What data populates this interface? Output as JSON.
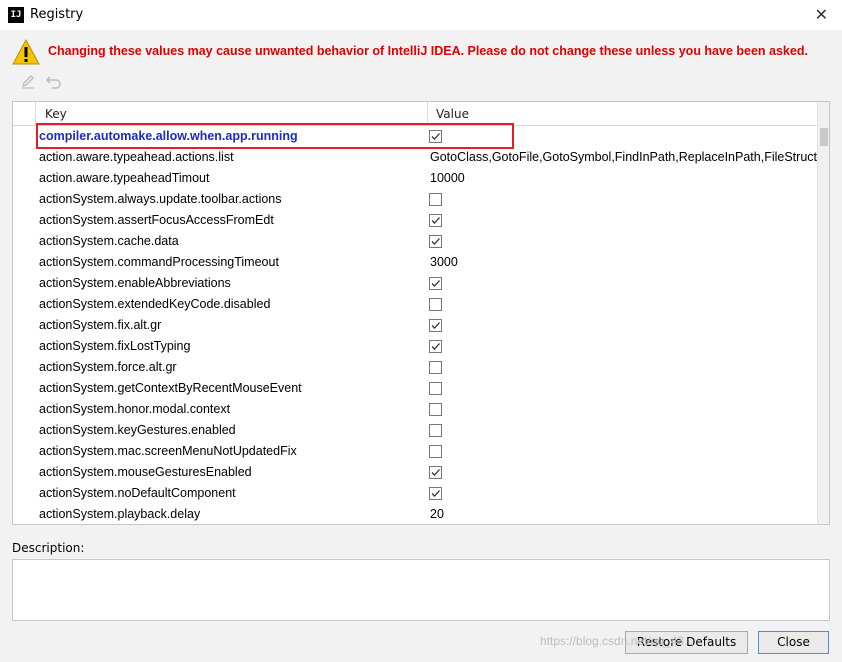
{
  "window": {
    "app_icon_text": "IJ",
    "title": "Registry"
  },
  "warning": {
    "text": "Changing these values may cause unwanted behavior of IntelliJ IDEA. Please do not change these unless you have been asked."
  },
  "table": {
    "columns": {
      "key": "Key",
      "value": "Value"
    },
    "rows": [
      {
        "key": "compiler.automake.allow.when.app.running",
        "type": "checkbox",
        "checked": true,
        "selected": true
      },
      {
        "key": "action.aware.typeahead.actions.list",
        "type": "text",
        "value": "GotoClass,GotoFile,GotoSymbol,FindInPath,ReplaceInPath,FileStruct"
      },
      {
        "key": "action.aware.typeaheadTimout",
        "type": "text",
        "value": "10000"
      },
      {
        "key": "actionSystem.always.update.toolbar.actions",
        "type": "checkbox",
        "checked": false
      },
      {
        "key": "actionSystem.assertFocusAccessFromEdt",
        "type": "checkbox",
        "checked": true
      },
      {
        "key": "actionSystem.cache.data",
        "type": "checkbox",
        "checked": true
      },
      {
        "key": "actionSystem.commandProcessingTimeout",
        "type": "text",
        "value": "3000"
      },
      {
        "key": "actionSystem.enableAbbreviations",
        "type": "checkbox",
        "checked": true
      },
      {
        "key": "actionSystem.extendedKeyCode.disabled",
        "type": "checkbox",
        "checked": false
      },
      {
        "key": "actionSystem.fix.alt.gr",
        "type": "checkbox",
        "checked": true
      },
      {
        "key": "actionSystem.fixLostTyping",
        "type": "checkbox",
        "checked": true
      },
      {
        "key": "actionSystem.force.alt.gr",
        "type": "checkbox",
        "checked": false
      },
      {
        "key": "actionSystem.getContextByRecentMouseEvent",
        "type": "checkbox",
        "checked": false
      },
      {
        "key": "actionSystem.honor.modal.context",
        "type": "checkbox",
        "checked": false
      },
      {
        "key": "actionSystem.keyGestures.enabled",
        "type": "checkbox",
        "checked": false
      },
      {
        "key": "actionSystem.mac.screenMenuNotUpdatedFix",
        "type": "checkbox",
        "checked": false
      },
      {
        "key": "actionSystem.mouseGesturesEnabled",
        "type": "checkbox",
        "checked": true
      },
      {
        "key": "actionSystem.noDefaultComponent",
        "type": "checkbox",
        "checked": true
      },
      {
        "key": "actionSystem.playback.delay",
        "type": "text",
        "value": "20"
      }
    ]
  },
  "description": {
    "label": "Description:"
  },
  "buttons": {
    "restore": "Restore Defaults",
    "close": "Close"
  },
  "watermark": "https://blog.csdn.net/qq_43...",
  "icons": {
    "warning": "warning-triangle-icon",
    "edit": "pencil-icon",
    "revert": "undo-icon",
    "close": "close-icon"
  },
  "colors": {
    "warning_text": "#e00000",
    "selected_key": "#1a2cc7",
    "highlight_box": "#e31e24"
  }
}
